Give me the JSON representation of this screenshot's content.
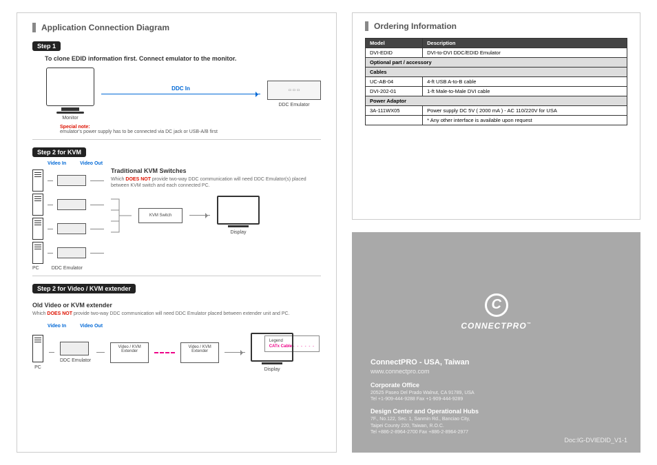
{
  "left": {
    "title": "Application Connection Diagram",
    "step1": {
      "badge": "Step 1",
      "instr": "To clone EDID information first. Connect emulator to the monitor.",
      "ddc_in": "DDC In",
      "monitor_label": "Monitor",
      "emulator_label": "DDC Emulator",
      "special_note_title": "Special note:",
      "special_note_body": "emulator's power supply has to be connected via DC jack or USB-A/B first"
    },
    "step2kvm": {
      "badge": "Step 2 for KVM",
      "video_in": "Video In",
      "video_out": "Video Out",
      "heading": "Traditional KVM Switches",
      "does_not": "DOES NOT",
      "body1": "Which ",
      "body2": " provide  two-way DDC communication will need DDC Emulator(s) placed between KVM switch and each connected PC.",
      "kvm_switch": "KVM Switch",
      "display": "Display",
      "pc_label": "PC",
      "emu_label": "DDC Emulator"
    },
    "step2ext": {
      "badge": "Step 2 for Video / KVM extender",
      "heading": "Old Video or KVM extender",
      "body1": "Which ",
      "does_not": "DOES NOT",
      "body2": " provide  two-way DDC communication will need DDC Emulator placed between extender unit and PC.",
      "video_in": "Video In",
      "video_out": "Video Out",
      "ext_box": "Video / KVM Extender",
      "pc_label": "PC",
      "emu_label": "DDC Emulator",
      "display": "Display",
      "legend_title": "Legend",
      "catx": "CATx Cable"
    }
  },
  "right": {
    "ordering_title": "Ordering Information",
    "table": {
      "h_model": "Model",
      "h_desc": "Description",
      "r1_model": "DVI-EDID",
      "r1_desc": "DVI-to-DVI DDC/EDID Emulator",
      "opt_header": "Optional part / accessory",
      "cables_header": "Cables",
      "r2_model": "UC-AB-04",
      "r2_desc": "4-ft USB A-to-B cable",
      "r3_model": "DVI-202-01",
      "r3_desc": "1-ft Male-to-Male DVI cable",
      "power_header": "Power Adaptor",
      "r4_model": "3A-111WX05",
      "r4_desc": "Power supply DC 5V ( 2000 mA ) - AC 110/220V for USA",
      "note": "* Any other interface is available upon request"
    },
    "brand": "CONNECTPRO",
    "tm": "™",
    "corp_title": "ConnectPRO - USA, Taiwan",
    "corp_url": "www.connectpro.com",
    "office_h": "Corporate Office",
    "office_addr": "20525  Paseo Del Prado Walnut, CA 91789, USA",
    "office_tel": "Tel   +1-909-444-9288     Fax  +1-909-444-9289",
    "design_h": "Design Center and Operational Hubs",
    "design_addr1": "7F., No.122, Sec. 1, Sanmin Rd., Banciao City,",
    "design_addr2": "Taipei County 220, Taiwan, R.O.C.",
    "design_tel": "Tel  +886-2-8964-2700    Fax  +886-2-8964-2977",
    "doc_id": "Doc:IG-DVIEDID_V1-1"
  }
}
